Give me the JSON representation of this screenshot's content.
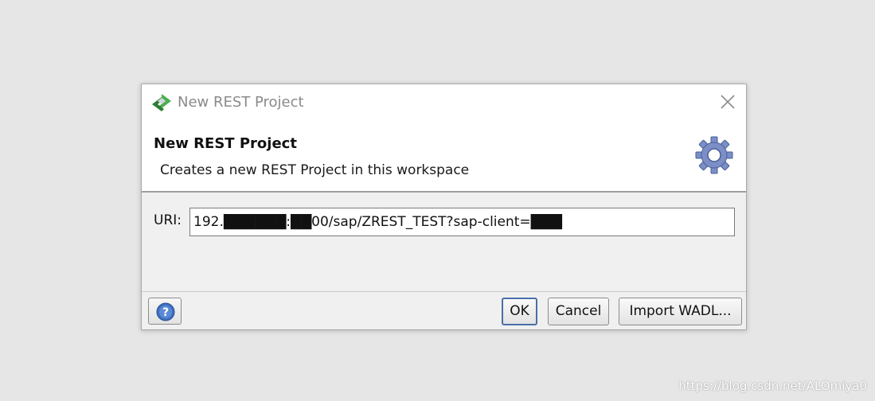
{
  "window": {
    "title": "New REST Project",
    "app_icon": "soapui-logo-icon",
    "close_icon": "close-icon"
  },
  "banner": {
    "title": "New REST Project",
    "description": "Creates a new REST Project in this workspace",
    "icon": "gear-icon"
  },
  "form": {
    "uri_label": "URI:",
    "uri_value": "192.██████:██00/sap/ZREST_TEST?sap-client=███"
  },
  "footer": {
    "help_icon": "help-icon",
    "ok_label": "OK",
    "cancel_label": "Cancel",
    "import_label": "Import WADL..."
  },
  "watermark": "https://blog.csdn.net/ALOmiya0",
  "colors": {
    "accent": "#4a6fa8",
    "background": "#e6e6e6",
    "dialog": "#f0f0f0"
  }
}
